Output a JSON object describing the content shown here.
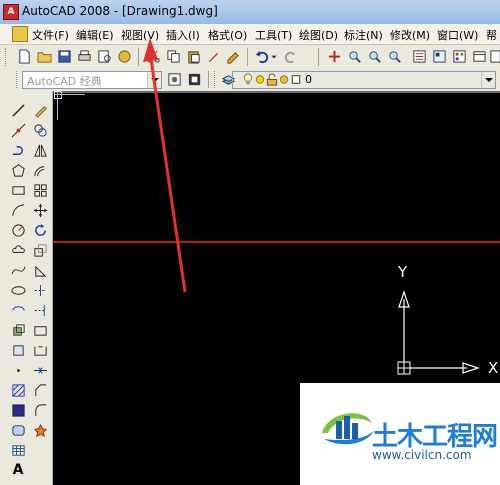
{
  "window": {
    "title": "AutoCAD 2008 - [Drawing1.dwg]"
  },
  "menu": {
    "items": [
      "文件(F)",
      "编辑(E)",
      "视图(V)",
      "插入(I)",
      "格式(O)",
      "工具(T)",
      "绘图(D)",
      "标注(N)",
      "修改(M)",
      "窗口(W)",
      "帮"
    ]
  },
  "toolbar": {
    "workspace_placeholder": "AutoCAD 经典",
    "layer_value": "0"
  },
  "left_toolbar": {
    "text_tool_label": "A"
  },
  "ucs": {
    "y_label": "Y",
    "x_label": "X"
  },
  "watermark": {
    "brand": "土木工程网",
    "url": "www.civilcn.com"
  },
  "colors": {
    "canvas_bg": "#000000",
    "red_line": "#c01818",
    "arrow": "#e0322e",
    "brand": "#1d7ed6"
  }
}
